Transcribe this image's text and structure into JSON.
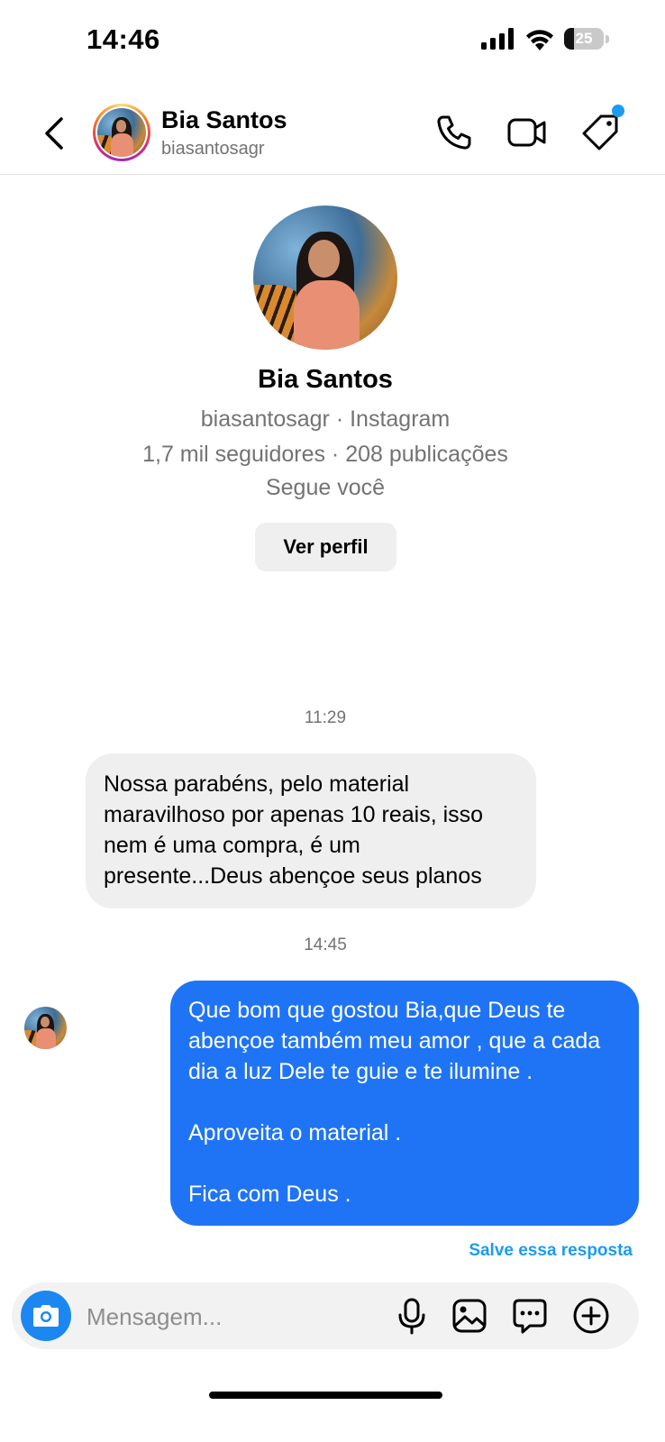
{
  "status_bar": {
    "time": "14:46",
    "battery_level": "25"
  },
  "header": {
    "name": "Bia Santos",
    "username": "biasantosagr",
    "icons": [
      "back-chevron-icon",
      "phone-icon",
      "video-camera-icon",
      "tag-icon"
    ],
    "notification_dot_color": "#1c9bf0"
  },
  "profile": {
    "name": "Bia Santos",
    "handle_line": "biasantosagr · Instagram",
    "stats_line": "1,7 mil seguidores · 208 publicações",
    "follow_status": "Segue você",
    "view_profile_label": "Ver perfil"
  },
  "messages": [
    {
      "timestamp": "11:29",
      "direction": "incoming",
      "text": "Nossa parabéns, pelo material maravilhoso por apenas 10 reais, isso nem é uma compra, é um presente...Deus abençoe seus planos"
    },
    {
      "timestamp": "14:45",
      "direction": "outgoing",
      "text": "Que bom que gostou Bia,que Deus te abençoe também meu amor , que a cada dia a luz Dele te guie e te ilumine .\n\nAproveita o material .\n\nFica com Deus ."
    }
  ],
  "save_reply_label": "Salve essa resposta",
  "composer": {
    "placeholder": "Mensagem...",
    "icons": [
      "camera-icon",
      "microphone-icon",
      "gallery-icon",
      "sticker-chat-icon",
      "plus-circle-icon"
    ]
  },
  "colors": {
    "outgoing_bubble": "#1f74f6",
    "incoming_bubble": "#efefef",
    "accent": "#1c9bf0"
  }
}
